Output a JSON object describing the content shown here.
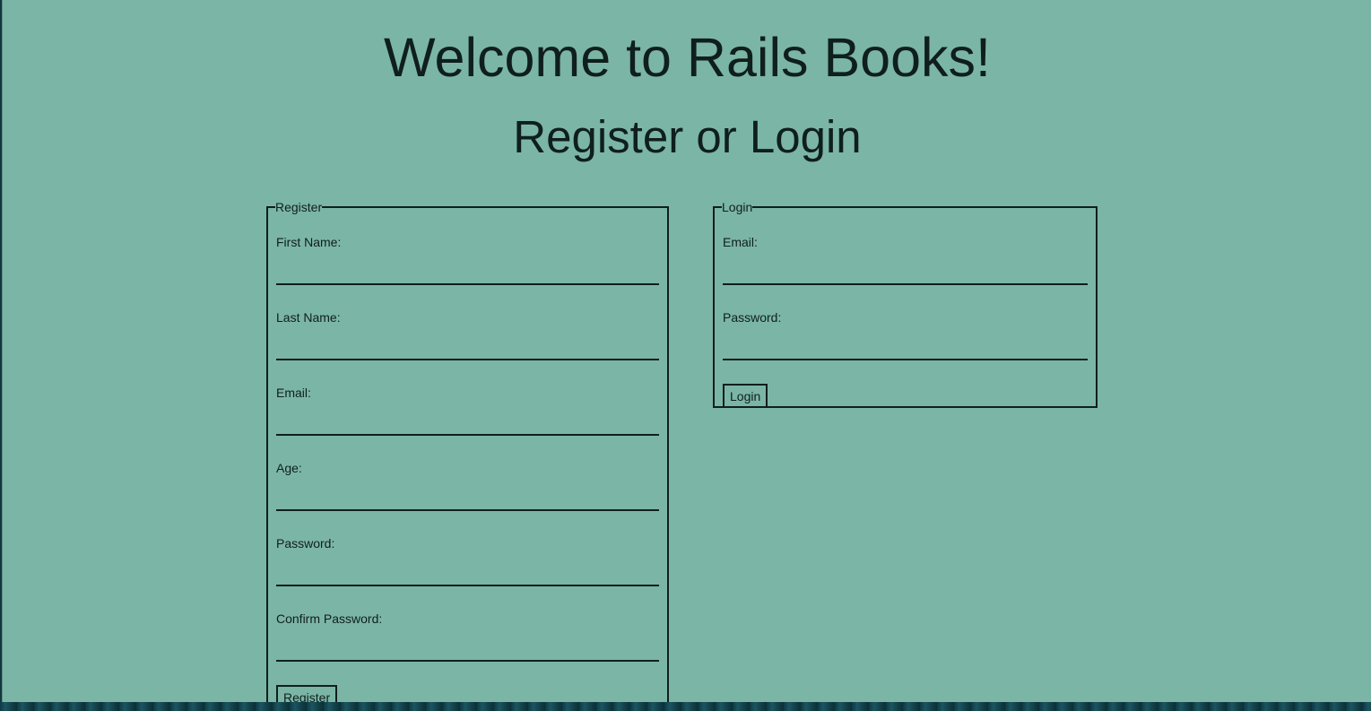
{
  "page": {
    "title": "Welcome to Rails Books!",
    "subtitle": "Register or Login"
  },
  "register": {
    "legend": "Register",
    "fields": [
      {
        "label": "First Name:",
        "value": ""
      },
      {
        "label": "Last Name:",
        "value": ""
      },
      {
        "label": "Email:",
        "value": ""
      },
      {
        "label": "Age:",
        "value": ""
      },
      {
        "label": "Password:",
        "value": ""
      },
      {
        "label": "Confirm Password:",
        "value": ""
      }
    ],
    "submit_label": "Register"
  },
  "login": {
    "legend": "Login",
    "fields": [
      {
        "label": "Email:",
        "value": ""
      },
      {
        "label": "Password:",
        "value": ""
      }
    ],
    "submit_label": "Login"
  },
  "colors": {
    "panel_background": "#7bb5a6",
    "text": "#0f1f1c",
    "page_background": "#12383f"
  }
}
